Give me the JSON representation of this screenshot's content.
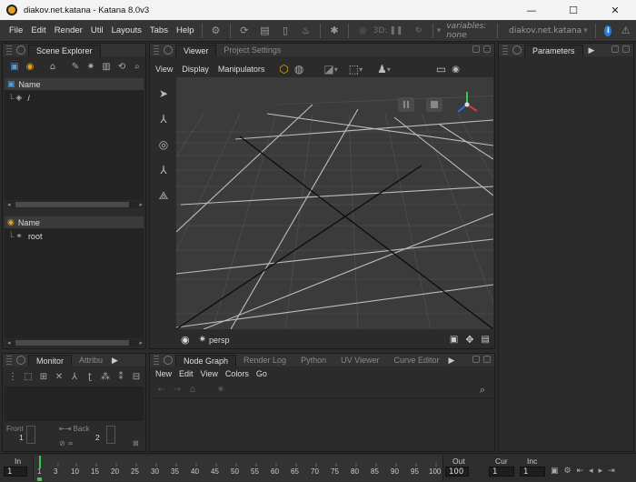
{
  "window": {
    "title": "diakov.net.katana - Katana 8.0v3",
    "minimize": "—",
    "maximize": "☐",
    "close": "✕"
  },
  "menubar": {
    "items": [
      "File",
      "Edit",
      "Render",
      "Util",
      "Layouts",
      "Tabs",
      "Help"
    ],
    "threed_label": "3D:",
    "variables": "variables: none",
    "server": "diakov.net.katana"
  },
  "scene_explorer": {
    "tabs": [
      "Scene Explorer"
    ],
    "header_name": "Name",
    "root_item": "/",
    "lower_header_name": "Name",
    "lower_root_item": "root"
  },
  "viewer": {
    "tabs": [
      "Viewer",
      "Project Settings"
    ],
    "menu": [
      "View",
      "Display",
      "Manipulators"
    ],
    "camera": "persp"
  },
  "parameters": {
    "tabs": [
      "Parameters"
    ]
  },
  "monitor": {
    "tabs": [
      "Monitor",
      "Attribu"
    ],
    "front_label": "Front",
    "front_value": "1",
    "back_label": "Back",
    "back_value": "2"
  },
  "node_graph": {
    "tabs": [
      "Node Graph",
      "Render Log",
      "Python",
      "UV Viewer",
      "Curve Editor"
    ],
    "menu": [
      "New",
      "Edit",
      "View",
      "Colors",
      "Go"
    ]
  },
  "timeline": {
    "in_label": "In",
    "in_value": "1",
    "out_label": "Out",
    "out_value": "100",
    "cur_label": "Cur",
    "cur_value": "1",
    "inc_label": "Inc",
    "inc_value": "1",
    "ticks": [
      "1",
      "3",
      "10",
      "15",
      "20",
      "25",
      "30",
      "35",
      "40",
      "45",
      "50",
      "55",
      "60",
      "65",
      "70",
      "75",
      "80",
      "85",
      "90",
      "95",
      "100"
    ]
  },
  "colors": {
    "accent": "#e4a21d",
    "info": "#2a7ed8",
    "grid_bg": "#3b3b3b"
  }
}
